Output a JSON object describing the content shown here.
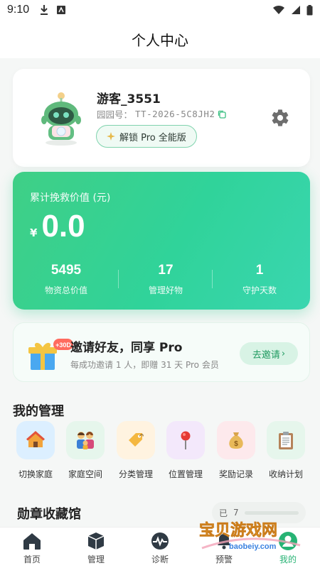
{
  "status_bar": {
    "time": "9:10"
  },
  "header": {
    "title": "个人中心"
  },
  "profile": {
    "username": "游客_3551",
    "garden_id_label": "园园号：",
    "garden_id": "TT-2026-5C8JH2",
    "unlock_label": "解锁 Pro 全能版"
  },
  "value_card": {
    "label": "累计挽救价值 (元)",
    "currency": "¥",
    "amount": "0.0",
    "stats": [
      {
        "value": "5495",
        "label": "物资总价值"
      },
      {
        "value": "17",
        "label": "管理好物"
      },
      {
        "value": "1",
        "label": "守护天数"
      }
    ]
  },
  "invite": {
    "badge": "+30D",
    "title": "邀请好友，同享 Pro",
    "subtitle": "每成功邀请 1 人，即赠 31 天 Pro 会员",
    "button_label": "去邀请",
    "button_chevron": "›"
  },
  "management": {
    "title": "我的管理",
    "items": [
      {
        "label": "切换家庭",
        "icon": "house-icon",
        "bg": "#dcefff"
      },
      {
        "label": "家庭空间",
        "icon": "family-icon",
        "bg": "#e6f6ec"
      },
      {
        "label": "分类管理",
        "icon": "tag-icon",
        "bg": "#fff3e0"
      },
      {
        "label": "位置管理",
        "icon": "pin-icon",
        "bg": "#f3e8fb"
      },
      {
        "label": "奖励记录",
        "icon": "money-bag-icon",
        "bg": "#fde9ec"
      },
      {
        "label": "收纳计划",
        "icon": "clipboard-icon",
        "bg": "#e6f6ec"
      }
    ]
  },
  "badges": {
    "title": "勋章收藏馆",
    "progress_prefix": "已",
    "progress_suffix": "7",
    "progress_fraction": 0
  },
  "tabs": [
    {
      "label": "首页",
      "icon": "home-icon"
    },
    {
      "label": "管理",
      "icon": "box-icon"
    },
    {
      "label": "诊断",
      "icon": "pulse-icon"
    },
    {
      "label": "预警",
      "icon": "bell-icon"
    },
    {
      "label": "我的",
      "icon": "profile-icon"
    }
  ],
  "watermark": {
    "text": "宝贝游戏网",
    "url": "baobeiy.com"
  },
  "colors": {
    "accent": "#27b374",
    "card_gradient_start": "#3fcf86",
    "card_gradient_end": "#3ad6b0"
  }
}
